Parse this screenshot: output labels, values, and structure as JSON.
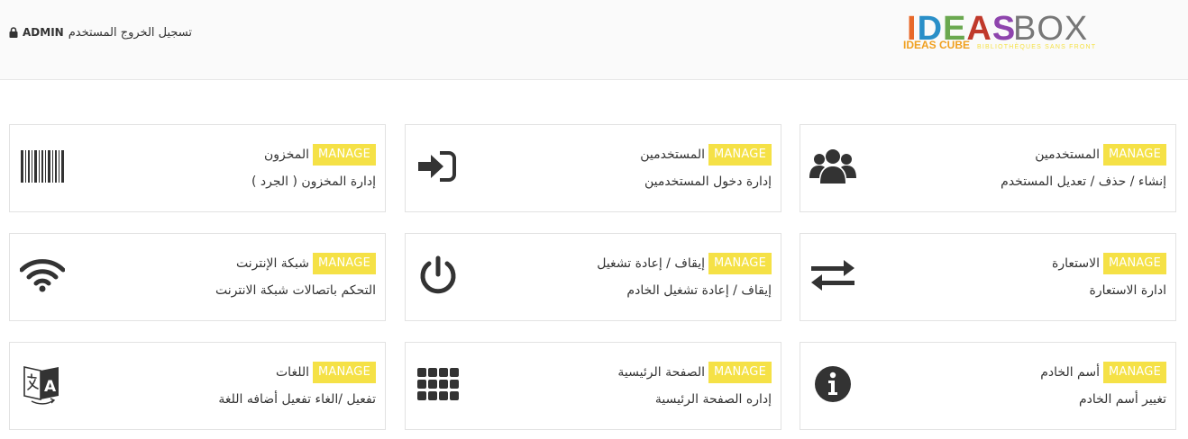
{
  "header": {
    "logout_text": "تسجيل الخروج المستخدم",
    "username": "ADMIN",
    "logo": {
      "letters": [
        "I",
        "D",
        "E",
        "A",
        "S",
        "B",
        "O",
        "X"
      ],
      "colors": [
        "#e8692a",
        "#2a8fc8",
        "#6aa84f",
        "#c0392b",
        "#8e44ad",
        "#777777",
        "#777777",
        "#777777"
      ],
      "sub_label": "IDEAS CUBE",
      "tagline": "BIBLIOTHÈQUES SANS FRONTIÈRES"
    }
  },
  "cards": [
    {
      "badge": "MANAGE",
      "title": "المستخدمين",
      "desc": "إنشاء / حذف / تعديل المستخدم",
      "icon": "users-icon"
    },
    {
      "badge": "MANAGE",
      "title": "المستخدمين",
      "desc": "إدارة دخول المستخدمين",
      "icon": "sign-in-icon"
    },
    {
      "badge": "MANAGE",
      "title": "المخزون",
      "desc": "إدارة المخزون ( الجرد )",
      "icon": "barcode-icon"
    },
    {
      "badge": "MANAGE",
      "title": "الاستعارة",
      "desc": "ادارة الاستعارة",
      "icon": "exchange-icon"
    },
    {
      "badge": "MANAGE",
      "title": "إيقاف / إعادة تشغيل",
      "desc": "إيقاف / إعادة تشغيل الخادم",
      "icon": "power-icon"
    },
    {
      "badge": "MANAGE",
      "title": "شبكة الإنترنت",
      "desc": "التحكم باتصالات شبكة الانترنت",
      "icon": "wifi-icon"
    },
    {
      "badge": "MANAGE",
      "title": "أسم الخادم",
      "desc": "تغيير أسم الخادم",
      "icon": "info-icon"
    },
    {
      "badge": "MANAGE",
      "title": "الصفحة الرئيسية",
      "desc": "إداره الصفحة الرئيسية",
      "icon": "grid-icon"
    },
    {
      "badge": "MANAGE",
      "title": "اللغات",
      "desc": "تفعيل /الغاء تفعيل أضافه اللغة",
      "icon": "language-icon"
    }
  ]
}
